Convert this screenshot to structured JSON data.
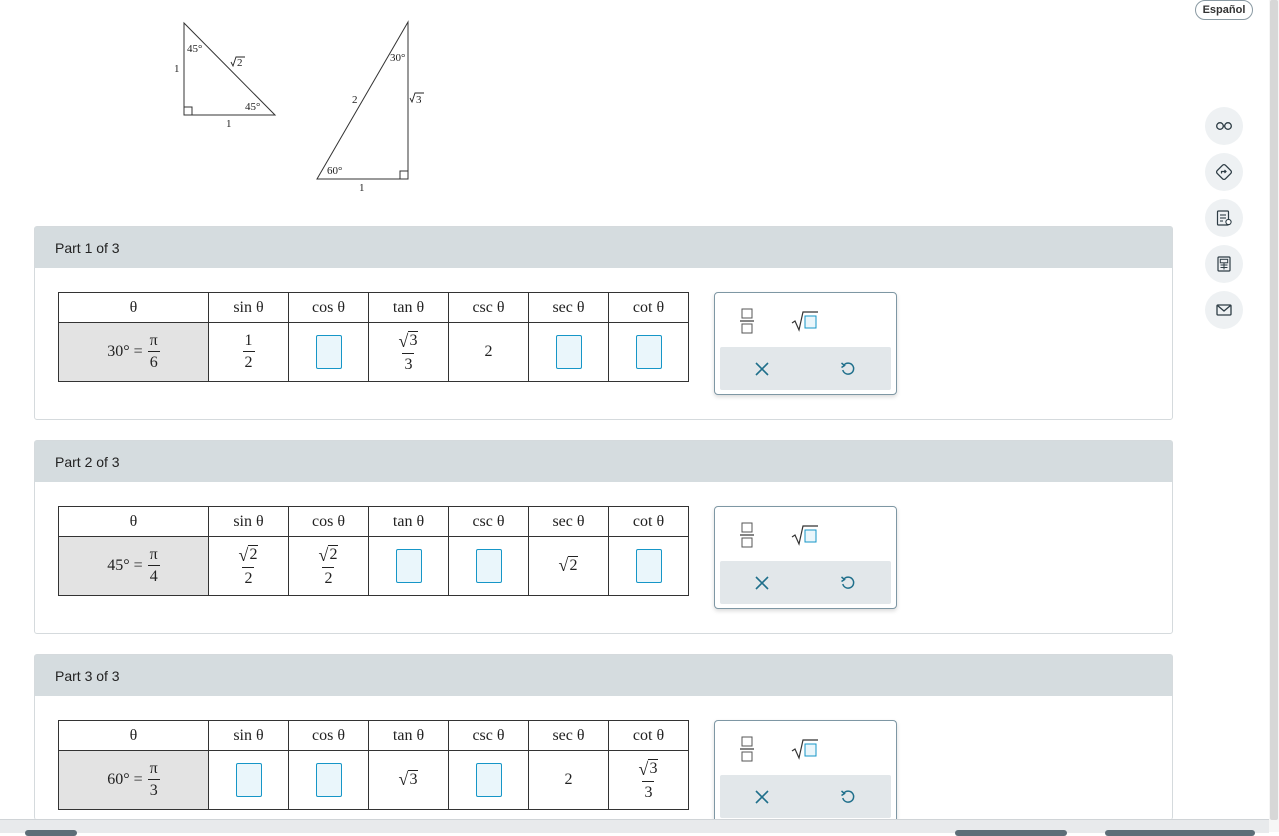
{
  "language_button": "Español",
  "toolbar_icons": [
    "glasses-icon",
    "navigate-icon",
    "notes-icon",
    "calculator-icon",
    "mail-icon"
  ],
  "diagram": {
    "tri45": {
      "angle_top": "45°",
      "angle_bottom": "45°",
      "leg_left": "1",
      "leg_bottom": "1",
      "hypotenuse_num": "2"
    },
    "tri30": {
      "angle_top": "30°",
      "angle_bottom": "60°",
      "leg_right_num": "3",
      "hypotenuse": "2",
      "leg_bottom": "1"
    }
  },
  "headers": {
    "theta": "θ",
    "sin": "sin θ",
    "cos": "cos θ",
    "tan": "tan θ",
    "csc": "csc θ",
    "sec": "sec θ",
    "cot": "cot θ"
  },
  "parts": [
    {
      "title": "Part 1 of 3",
      "degrees": "30° =",
      "pi": "π",
      "den": "6",
      "sin_num": "1",
      "sin_den": "2",
      "tan_rad": "3",
      "tan_den": "3",
      "csc": "2"
    },
    {
      "title": "Part 2 of 3",
      "degrees": "45° =",
      "pi": "π",
      "den": "4",
      "sin_rad": "2",
      "sin_den": "2",
      "cos_rad": "2",
      "cos_den": "2",
      "sec_rad": "2"
    },
    {
      "title": "Part 3 of 3",
      "degrees": "60° =",
      "pi": "π",
      "den": "3",
      "tan_rad": "3",
      "sec": "2",
      "cot_rad": "3",
      "cot_den": "3"
    }
  ],
  "palette": {
    "buttons": [
      "fraction-template-icon",
      "square-root-template-icon"
    ],
    "actions": [
      "clear-icon",
      "undo-icon"
    ]
  },
  "colors": {
    "accent": "#1696c7",
    "header_bg": "#d5dcdf",
    "theta_bg": "#e3e3e3",
    "palette_action_color": "#1f6f8b"
  }
}
